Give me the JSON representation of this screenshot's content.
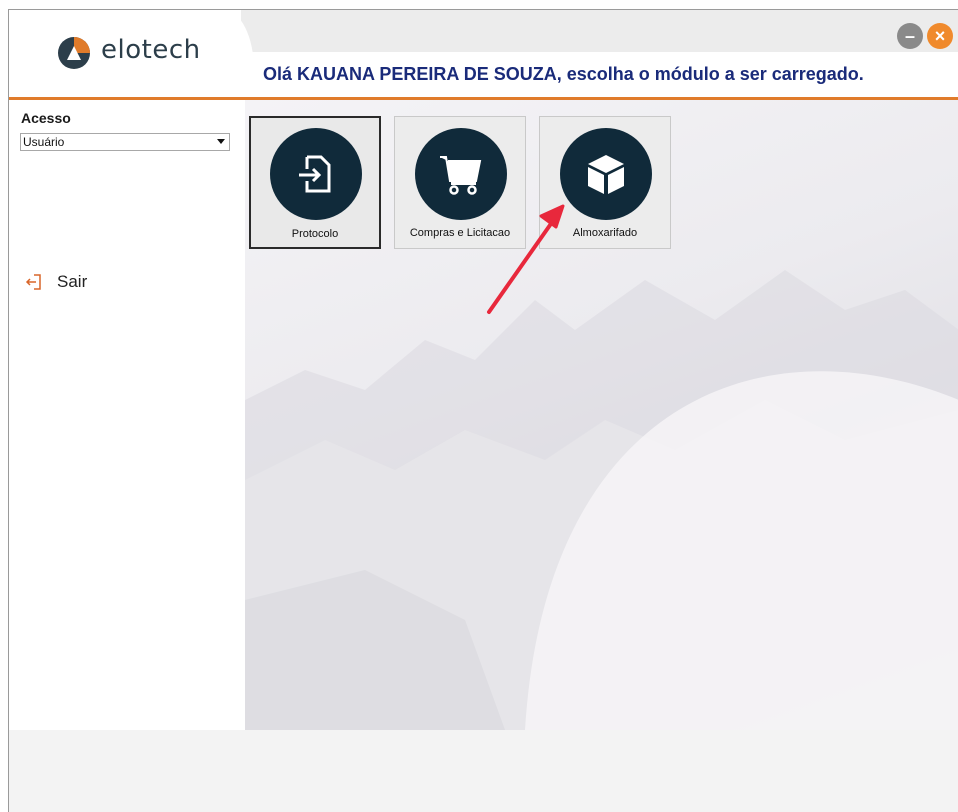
{
  "header": {
    "logo_text": "elotech",
    "greeting": "Olá KAUANA  PEREIRA DE SOUZA, escolha o módulo a ser carregado."
  },
  "window_controls": {
    "minimize_icon": "minimize-icon",
    "close_icon": "close-icon"
  },
  "sidebar": {
    "access_label": "Acesso",
    "access_select_value": "Usuário",
    "exit_label": "Sair"
  },
  "modules": [
    {
      "label": "Protocolo",
      "icon": "file-import-icon"
    },
    {
      "label": "Compras e Licitacao",
      "icon": "shopping-cart-icon"
    },
    {
      "label": "Almoxarifado",
      "icon": "box-icon"
    }
  ],
  "colors": {
    "accent": "#e07b2a",
    "greeting": "#1a2b7a",
    "module_circle": "#102a3a",
    "annotation_arrow": "#e8283c"
  }
}
